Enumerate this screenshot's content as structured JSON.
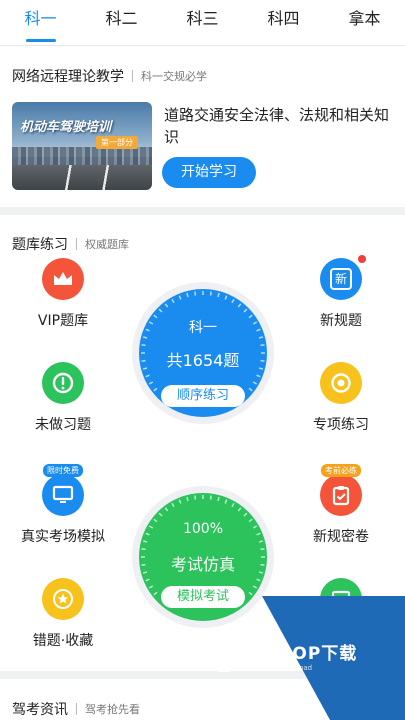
{
  "tabs": [
    {
      "label": "科一",
      "active": true
    },
    {
      "label": "科二",
      "active": false
    },
    {
      "label": "科三",
      "active": false
    },
    {
      "label": "科四",
      "active": false
    },
    {
      "label": "拿本",
      "active": false
    }
  ],
  "remote_section": {
    "title": "网络远程理论教学",
    "subtitle": "科一交规必学"
  },
  "course": {
    "image_banner": "机动车驾驶培训",
    "image_tag": "第一部分",
    "title": "道路交通安全法律、法规和相关知识",
    "button": "开始学习"
  },
  "bank_section": {
    "title": "题库练习",
    "subtitle": "权威题库"
  },
  "items": {
    "vip": {
      "label": "VIP题库",
      "color": "#f4553a",
      "icon": "crown-icon"
    },
    "new_rules": {
      "label": "新规题",
      "color": "#1a8cf0",
      "icon": "new-icon",
      "icon_text": "新"
    },
    "undone": {
      "label": "未做习题",
      "color": "#2cc25c",
      "icon": "exclamation-icon"
    },
    "special": {
      "label": "专项练习",
      "color": "#f6c21b",
      "icon": "target-icon"
    },
    "exam_sim": {
      "label": "真实考场模拟",
      "color": "#1a8cf0",
      "icon": "monitor-icon",
      "tag": "限时免费",
      "tag_color": "#1a8cf0"
    },
    "secret": {
      "label": "新规密卷",
      "color": "#f4553a",
      "icon": "clipboard-icon",
      "tag": "考前必练",
      "tag_color": "#f4a21b"
    },
    "errors": {
      "label": "错题·收藏",
      "color": "#f6c21b",
      "icon": "star-icon"
    }
  },
  "order_circle": {
    "subject": "科一",
    "count": "共1654题",
    "action": "顺序练习",
    "color": "#1a8cf0"
  },
  "exam_circle": {
    "percent": "100%",
    "name": "考试仿真",
    "action": "模拟考试",
    "color": "#2cc25c"
  },
  "news_section": {
    "title": "驾考资讯",
    "subtitle": "驾考抢先看"
  },
  "watermark": {
    "brand": "PCPOP下载",
    "sub": "PCPOP Download"
  }
}
